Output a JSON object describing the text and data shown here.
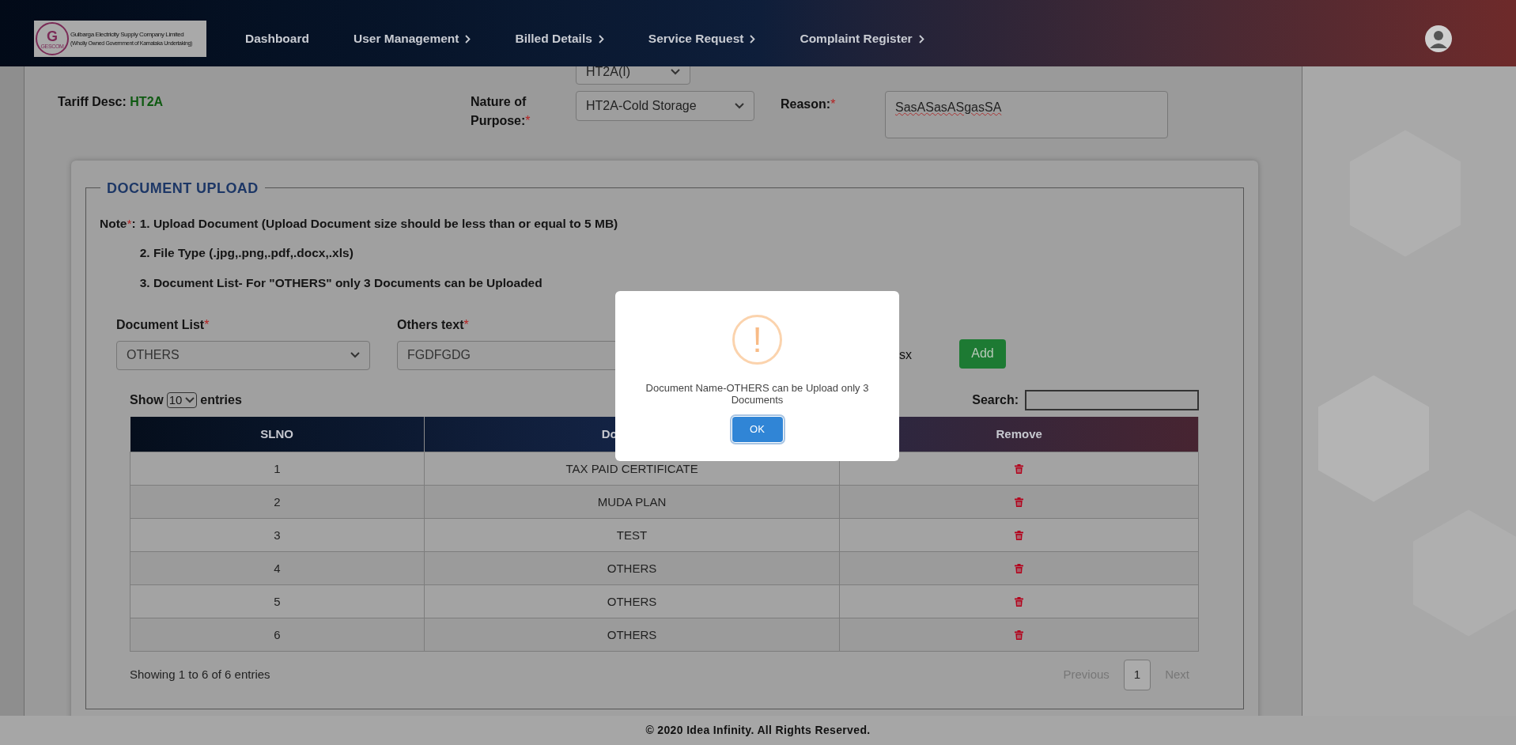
{
  "header": {
    "logo": {
      "mark": "G",
      "seal": "GESCOM",
      "title": "Gulbarga Electricity Supply Company Limited",
      "subtitle": "(Wholly Owned Government of Karnataka Undertaking)"
    },
    "nav": [
      {
        "label": "Dashboard",
        "has_submenu": false
      },
      {
        "label": "User Management",
        "has_submenu": true
      },
      {
        "label": "Billed Details",
        "has_submenu": true
      },
      {
        "label": "Service Request",
        "has_submenu": true
      },
      {
        "label": "Complaint Register",
        "has_submenu": true
      }
    ]
  },
  "form": {
    "category_value": "HT2A(I)",
    "tariff_desc": {
      "label": "Tariff Desc:",
      "value": "HT2A"
    },
    "purpose": {
      "label": "Nature of Purpose:",
      "mark": "*",
      "value": "HT2A-Cold Storage"
    },
    "reason": {
      "label": "Reason:",
      "mark": "*",
      "value": "SasASasASgasSA"
    }
  },
  "document_upload": {
    "title": "DOCUMENT UPLOAD",
    "note_label": "Note",
    "note_mark": "*",
    "note_sep": ":",
    "notes": [
      "1. Upload Document (Upload Document size should be less than or equal to 5 MB)",
      "2. File Type (.jpg,.png,.pdf,.docx,.xls)",
      "3. Document List- For \"OTHERS\" only 3 Documents can be Uploaded"
    ],
    "document_list": {
      "label": "Document List",
      "mark": "*",
      "value": "OTHERS"
    },
    "others_text": {
      "label": "Others text",
      "mark": "*",
      "value": "FGDFGDG"
    },
    "file_name": "sx",
    "add_button": "Add",
    "show_label": "Show",
    "page_size": "10",
    "entries_label": "entries",
    "search_label": "Search:",
    "table": {
      "columns": [
        "SLNO",
        "Do",
        "Remove"
      ],
      "rows": [
        {
          "slno": "1",
          "document": "TAX PAID CERTIFICATE"
        },
        {
          "slno": "2",
          "document": "MUDA PLAN"
        },
        {
          "slno": "3",
          "document": "TEST"
        },
        {
          "slno": "4",
          "document": "OTHERS"
        },
        {
          "slno": "5",
          "document": "OTHERS"
        },
        {
          "slno": "6",
          "document": "OTHERS"
        }
      ]
    },
    "info": "Showing 1 to 6 of 6 entries",
    "pagination": {
      "previous": "Previous",
      "pages": [
        {
          "label": "1",
          "selected": true
        }
      ],
      "next": "Next"
    }
  },
  "dialog": {
    "icon": "!",
    "message": "Document Name-OTHERS can be Upload only 3 Documents",
    "ok": "OK"
  },
  "footer": "© 2020 Idea Infinity. All Rights Reserved."
}
